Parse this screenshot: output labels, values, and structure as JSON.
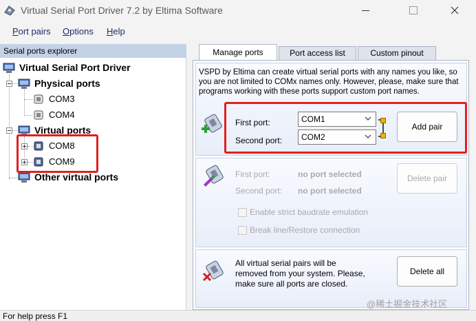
{
  "window": {
    "title": "Virtual Serial Port Driver 7.2 by Eltima Software"
  },
  "menu": [
    {
      "label": "Port pairs",
      "accel": "P",
      "rest": "ort pairs"
    },
    {
      "label": "Options",
      "accel": "O",
      "rest": "ptions"
    },
    {
      "label": "Help",
      "accel": "H",
      "rest": "elp"
    }
  ],
  "explorer": {
    "header": "Serial ports explorer",
    "root": "Virtual Serial Port Driver",
    "physical_group": "Physical ports",
    "physical_ports": [
      "COM3",
      "COM4"
    ],
    "virtual_group": "Virtual ports",
    "virtual_ports": [
      "COM8",
      "COM9"
    ],
    "other_group": "Other virtual ports"
  },
  "tabs": [
    "Manage ports",
    "Port access list",
    "Custom pinout"
  ],
  "manage": {
    "description": "VSPD by Eltima can create virtual serial ports with any names you like, so you are not limited to COMx names only. However, please, make sure that programs working with these ports support custom port names.",
    "first_port_label": "First port:",
    "second_port_label": "Second port:",
    "first_port_value": "COM1",
    "second_port_value": "COM2",
    "add_pair": "Add pair"
  },
  "delete_section": {
    "first_port_label": "First port:",
    "second_port_label": "Second port:",
    "first_port_value": "no port selected",
    "second_port_value": "no port selected",
    "delete_pair": "Delete pair",
    "strict_baud": "Enable strict baudrate emulation",
    "break_line": "Break line/Restore connection"
  },
  "delete_all_section": {
    "text": "All virtual serial pairs will be removed from your system. Please, make sure all ports are closed.",
    "delete_all": "Delete all"
  },
  "status": "For help press F1",
  "watermark": "@稀土掘金技术社区",
  "colors": {
    "highlight_red": "#e02020",
    "explorer_header": "#c4d2e7"
  }
}
